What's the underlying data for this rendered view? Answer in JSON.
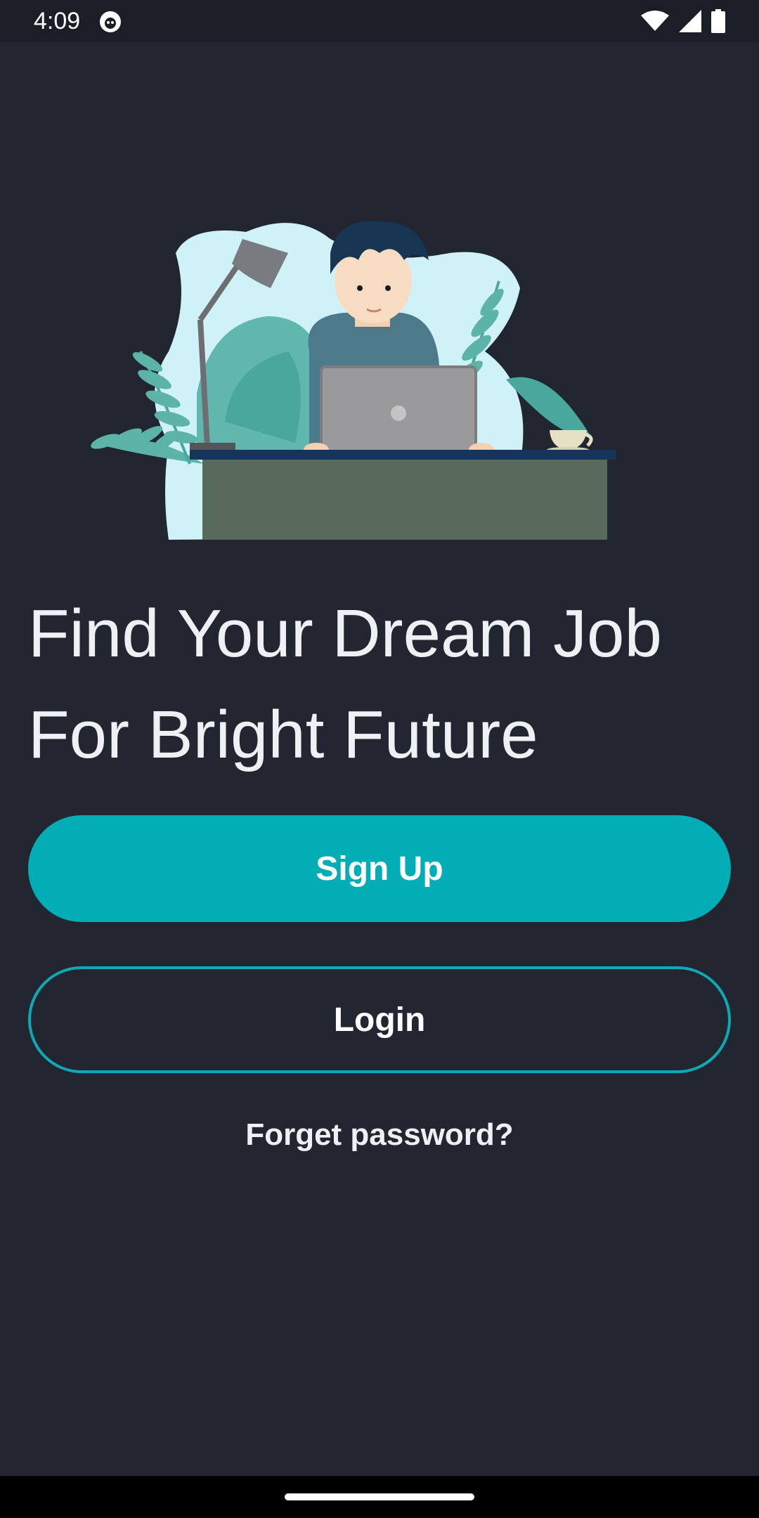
{
  "status_bar": {
    "time": "4:09",
    "icons": [
      "app-notification-icon",
      "wifi-icon",
      "signal-icon",
      "battery-icon"
    ]
  },
  "hero": {
    "illustration": "person-working-on-laptop-at-desk-with-plants"
  },
  "headline": {
    "line1": "Find Your Dream Job",
    "line2": "For Bright Future"
  },
  "actions": {
    "signup_label": "Sign Up",
    "login_label": "Login",
    "forgot_label": "Forget password?"
  },
  "colors": {
    "background": "#212631",
    "accent": "#02adb5",
    "text": "#eef0f3"
  }
}
